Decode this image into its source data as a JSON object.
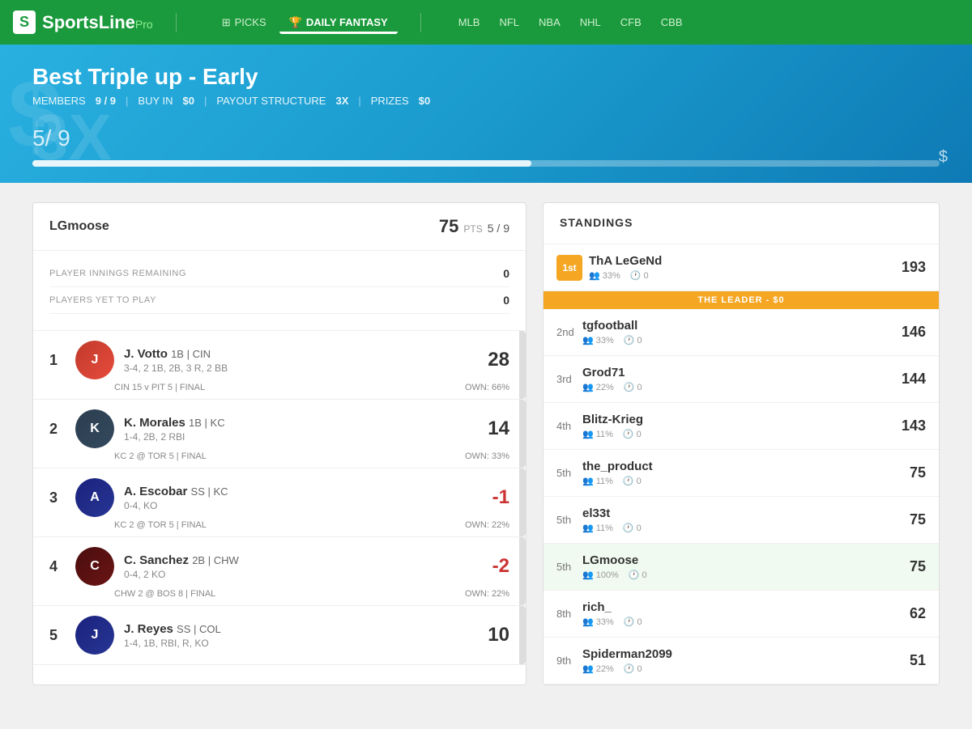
{
  "header": {
    "logo_box": "S",
    "logo_name": "SportsLine",
    "logo_pro": "Pro",
    "nav_picks": "PICKS",
    "nav_daily_fantasy": "DAILY FANTASY",
    "sports": [
      "MLB",
      "NFL",
      "NBA",
      "NHL",
      "CFB",
      "CBB"
    ]
  },
  "banner": {
    "title": "Best Triple up - Early",
    "members_label": "MEMBERS",
    "members_value": "9 / 9",
    "buyin_label": "BUY IN",
    "buyin_value": "$0",
    "payout_label": "PAYOUT STRUCTURE",
    "payout_value": "3X",
    "prizes_label": "PRIZES",
    "prizes_value": "$0",
    "score": "5",
    "score_total": "/ 9",
    "dollar": "$",
    "bg_3x": "3X",
    "bg_dollar": "$"
  },
  "left_panel": {
    "username": "LGmoose",
    "pts": "75",
    "pts_label": "PTS",
    "rank": "5 / 9",
    "innings_label": "PLAYER INNINGS REMAINING",
    "innings_value": "0",
    "yet_to_play_label": "PLAYERS YET TO PLAY",
    "yet_to_play_value": "0",
    "players": [
      {
        "num": "1",
        "name": "J. Votto",
        "pos": "1B",
        "team": "CIN",
        "stats": "3-4, 2 1B, 2B, 3 R, 2 BB",
        "score": "28",
        "negative": false,
        "game": "CIN 15 v PIT 5 | FINAL",
        "own": "OWN: 66%"
      },
      {
        "num": "2",
        "name": "K. Morales",
        "pos": "1B",
        "team": "KC",
        "stats": "1-4, 2B, 2 RBI",
        "score": "14",
        "negative": false,
        "game": "KC 2 @ TOR 5 | FINAL",
        "own": "OWN: 33%"
      },
      {
        "num": "3",
        "name": "A. Escobar",
        "pos": "SS",
        "team": "KC",
        "stats": "0-4, KO",
        "score": "-1",
        "negative": true,
        "game": "KC 2 @ TOR 5 | FINAL",
        "own": "OWN: 22%"
      },
      {
        "num": "4",
        "name": "C. Sanchez",
        "pos": "2B",
        "team": "CHW",
        "stats": "0-4, 2 KO",
        "score": "-2",
        "negative": true,
        "game": "CHW 2 @ BOS 8 | FINAL",
        "own": "OWN: 22%"
      },
      {
        "num": "5",
        "name": "J. Reyes",
        "pos": "SS",
        "team": "COL",
        "stats": "1-4, 1B, RBI, R, KO",
        "score": "10",
        "negative": false,
        "game": "",
        "own": ""
      }
    ]
  },
  "standings": {
    "title": "STANDINGS",
    "entries": [
      {
        "rank": "1st",
        "is_first": true,
        "name": "ThA LeGeNd",
        "ownership": "33%",
        "timer": "0",
        "score": "193",
        "is_leader": true,
        "is_me": false,
        "leader_text": "THE LEADER - $0"
      },
      {
        "rank": "2nd",
        "is_first": false,
        "name": "tgfootball",
        "ownership": "33%",
        "timer": "0",
        "score": "146",
        "is_leader": false,
        "is_me": false
      },
      {
        "rank": "3rd",
        "is_first": false,
        "name": "Grod71",
        "ownership": "22%",
        "timer": "0",
        "score": "144",
        "is_leader": false,
        "is_me": false
      },
      {
        "rank": "4th",
        "is_first": false,
        "name": "Blitz-Krieg",
        "ownership": "11%",
        "timer": "0",
        "score": "143",
        "is_leader": false,
        "is_me": false
      },
      {
        "rank": "5th",
        "is_first": false,
        "name": "the_product",
        "ownership": "11%",
        "timer": "0",
        "score": "75",
        "is_leader": false,
        "is_me": false
      },
      {
        "rank": "5th",
        "is_first": false,
        "name": "el33t",
        "ownership": "11%",
        "timer": "0",
        "score": "75",
        "is_leader": false,
        "is_me": false
      },
      {
        "rank": "5th",
        "is_first": false,
        "name": "LGmoose",
        "ownership": "100%",
        "timer": "0",
        "score": "75",
        "is_leader": false,
        "is_me": true
      },
      {
        "rank": "8th",
        "is_first": false,
        "name": "rich_",
        "ownership": "33%",
        "timer": "0",
        "score": "62",
        "is_leader": false,
        "is_me": false
      },
      {
        "rank": "9th",
        "is_first": false,
        "name": "Spiderman2099",
        "ownership": "22%",
        "timer": "0",
        "score": "51",
        "is_leader": false,
        "is_me": false
      }
    ]
  }
}
